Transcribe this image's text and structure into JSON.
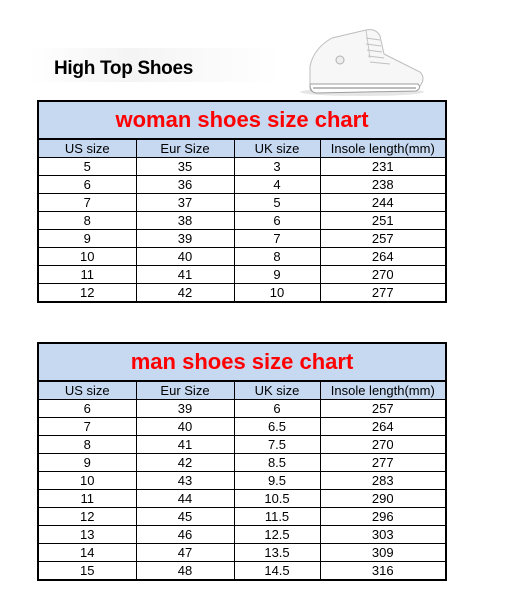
{
  "header": {
    "brand_title": "High Top Shoes",
    "shoe_image": "white-high-top-sneaker"
  },
  "colors": {
    "title_text": "#ff0000",
    "header_fill": "#c6d9f1",
    "border": "#000000"
  },
  "columns": [
    "US size",
    "Eur Size",
    "UK size",
    "Insole length(mm)"
  ],
  "man_columns": [
    "US size",
    "Eur Size",
    "UK size",
    "Insole length(mm)"
  ],
  "woman": {
    "title": "woman shoes size chart",
    "rows": [
      [
        "5",
        "35",
        "3",
        "231"
      ],
      [
        "6",
        "36",
        "4",
        "238"
      ],
      [
        "7",
        "37",
        "5",
        "244"
      ],
      [
        "8",
        "38",
        "6",
        "251"
      ],
      [
        "9",
        "39",
        "7",
        "257"
      ],
      [
        "10",
        "40",
        "8",
        "264"
      ],
      [
        "11",
        "41",
        "9",
        "270"
      ],
      [
        "12",
        "42",
        "10",
        "277"
      ]
    ]
  },
  "man": {
    "title": "man shoes size chart",
    "rows": [
      [
        "6",
        "39",
        "6",
        "257"
      ],
      [
        "7",
        "40",
        "6.5",
        "264"
      ],
      [
        "8",
        "41",
        "7.5",
        "270"
      ],
      [
        "9",
        "42",
        "8.5",
        "277"
      ],
      [
        "10",
        "43",
        "9.5",
        "283"
      ],
      [
        "11",
        "44",
        "10.5",
        "290"
      ],
      [
        "12",
        "45",
        "11.5",
        "296"
      ],
      [
        "13",
        "46",
        "12.5",
        "303"
      ],
      [
        "14",
        "47",
        "13.5",
        "309"
      ],
      [
        "15",
        "48",
        "14.5",
        "316"
      ]
    ]
  }
}
